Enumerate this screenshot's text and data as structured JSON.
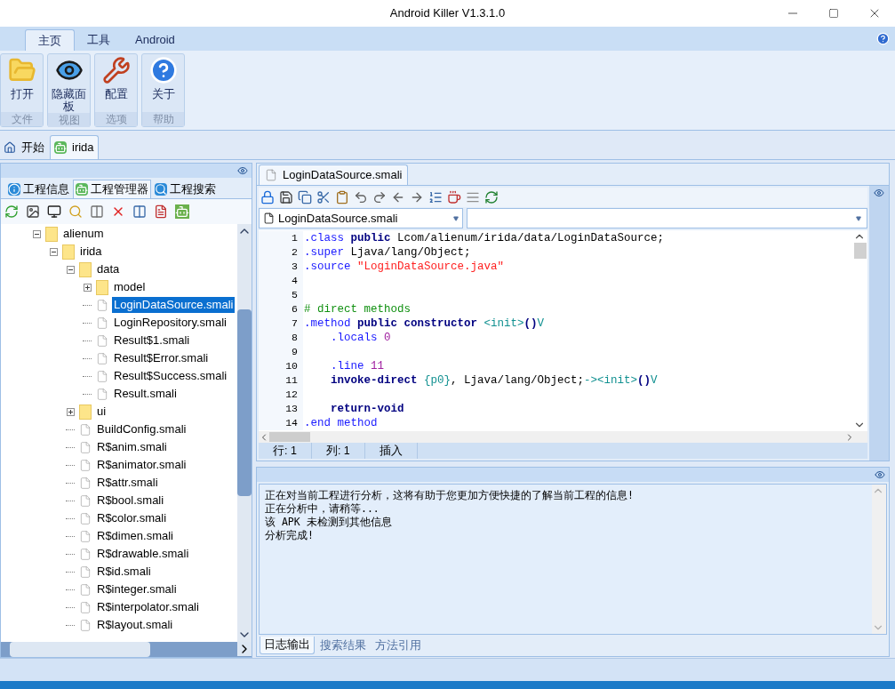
{
  "window": {
    "title": "Android Killer V1.3.1.0"
  },
  "ribbon_tabs": [
    {
      "label": "主页",
      "selected": true
    },
    {
      "label": "工具",
      "selected": false
    },
    {
      "label": "Android",
      "selected": false
    }
  ],
  "ribbon_groups": [
    {
      "label": "文件",
      "buttons": [
        {
          "kind": "open",
          "label": "打开"
        }
      ]
    },
    {
      "label": "视图",
      "buttons": [
        {
          "kind": "eye",
          "label": "隐藏面板"
        }
      ]
    },
    {
      "label": "选项",
      "buttons": [
        {
          "kind": "tools",
          "label": "配置"
        }
      ]
    },
    {
      "label": "帮助",
      "buttons": [
        {
          "kind": "help",
          "label": "关于"
        }
      ]
    }
  ],
  "doc_tabs": [
    {
      "kind": "home",
      "label": "开始",
      "selected": false
    },
    {
      "kind": "android",
      "label": "irida",
      "selected": true
    }
  ],
  "left_panel": {
    "tabs": [
      {
        "kind": "info",
        "label": "工程信息",
        "selected": false
      },
      {
        "kind": "android",
        "label": "工程管理器",
        "selected": true
      },
      {
        "kind": "search",
        "label": "工程搜索",
        "selected": false
      }
    ],
    "tree": [
      {
        "kind": "folder",
        "label": "alienum",
        "expanded": true,
        "children": [
          {
            "kind": "folder",
            "label": "irida",
            "expanded": true,
            "children": [
              {
                "kind": "folder",
                "label": "data",
                "expanded": true,
                "children": [
                  {
                    "kind": "folder",
                    "label": "model",
                    "expanded": false
                  },
                  {
                    "kind": "file",
                    "label": "LoginDataSource.smali",
                    "selected": true
                  },
                  {
                    "kind": "file",
                    "label": "LoginRepository.smali",
                    "selected": false
                  },
                  {
                    "kind": "file",
                    "label": "Result$1.smali",
                    "selected": false
                  },
                  {
                    "kind": "file",
                    "label": "Result$Error.smali",
                    "selected": false
                  },
                  {
                    "kind": "file",
                    "label": "Result$Success.smali",
                    "selected": false
                  },
                  {
                    "kind": "file",
                    "label": "Result.smali",
                    "selected": false
                  }
                ]
              },
              {
                "kind": "folder",
                "label": "ui",
                "expanded": false
              },
              {
                "kind": "file",
                "label": "BuildConfig.smali",
                "selected": false
              },
              {
                "kind": "file",
                "label": "R$anim.smali",
                "selected": false
              },
              {
                "kind": "file",
                "label": "R$animator.smali",
                "selected": false
              },
              {
                "kind": "file",
                "label": "R$attr.smali",
                "selected": false
              },
              {
                "kind": "file",
                "label": "R$bool.smali",
                "selected": false
              },
              {
                "kind": "file",
                "label": "R$color.smali",
                "selected": false
              },
              {
                "kind": "file",
                "label": "R$dimen.smali",
                "selected": false
              },
              {
                "kind": "file",
                "label": "R$drawable.smali",
                "selected": false
              },
              {
                "kind": "file",
                "label": "R$id.smali",
                "selected": false
              },
              {
                "kind": "file",
                "label": "R$integer.smali",
                "selected": false
              },
              {
                "kind": "file",
                "label": "R$interpolator.smali",
                "selected": false
              },
              {
                "kind": "file",
                "label": "R$layout.smali",
                "selected": false
              }
            ]
          }
        ]
      }
    ]
  },
  "editor": {
    "tab": "LoginDataSource.smali",
    "file_select": "LoginDataSource.smali",
    "lines": [
      {
        "number": "1",
        "tokens": [
          {
            "kind": "directive",
            "text": ".class"
          },
          {
            "kind": "keyword",
            "text": " public"
          },
          {
            "kind": "plain",
            "text": " Lcom/alienum/irida/data/LoginDataSource;"
          }
        ]
      },
      {
        "number": "2",
        "tokens": [
          {
            "kind": "directive",
            "text": ".super"
          },
          {
            "kind": "plain",
            "text": " Ljava/lang/Object;"
          }
        ]
      },
      {
        "number": "3",
        "tokens": [
          {
            "kind": "directive",
            "text": ".source"
          },
          {
            "kind": "string",
            "text": " \"LoginDataSource.java\""
          }
        ]
      },
      {
        "number": "4"
      },
      {
        "number": "5"
      },
      {
        "number": "6",
        "tokens": [
          {
            "kind": "comment",
            "text": "# direct methods"
          }
        ]
      },
      {
        "number": "7",
        "tokens": [
          {
            "kind": "directive",
            "text": ".method"
          },
          {
            "kind": "keyword",
            "text": " public constructor"
          },
          {
            "kind": "type",
            "text": " <init>"
          },
          {
            "kind": "keyword",
            "text": "()"
          },
          {
            "kind": "type",
            "text": "V"
          }
        ]
      },
      {
        "number": "8",
        "tokens": [
          {
            "kind": "directive",
            "text": "    .locals"
          },
          {
            "kind": "number",
            "text": " 0"
          }
        ]
      },
      {
        "number": "9"
      },
      {
        "number": "10",
        "tokens": [
          {
            "kind": "directive",
            "text": "    .line"
          },
          {
            "kind": "number",
            "text": " 11"
          }
        ]
      },
      {
        "number": "11",
        "tokens": [
          {
            "kind": "keyword",
            "text": "    invoke-direct"
          },
          {
            "kind": "type",
            "text": " {p0}"
          },
          {
            "kind": "plain",
            "text": ", Ljava/lang/Object;"
          },
          {
            "kind": "type",
            "text": "-><init>"
          },
          {
            "kind": "keyword",
            "text": "()"
          },
          {
            "kind": "type",
            "text": "V"
          }
        ]
      },
      {
        "number": "12"
      },
      {
        "number": "13",
        "tokens": [
          {
            "kind": "keyword",
            "text": "    return-void"
          }
        ]
      },
      {
        "number": "14",
        "tokens": [
          {
            "kind": "directive",
            "text": ".end method"
          }
        ]
      }
    ],
    "status": [
      "行: 1",
      "列: 1",
      "插入"
    ]
  },
  "log": {
    "lines": [
      "正在对当前工程进行分析，这将有助于您更加方便快捷的了解当前工程的信息!",
      "正在分析中，请稍等...",
      "该 APK 未检测到其他信息",
      "分析完成!"
    ],
    "tabs": [
      {
        "label": "日志输出",
        "selected": true
      },
      {
        "label": "搜索结果",
        "selected": false
      },
      {
        "label": "方法引用",
        "selected": false
      }
    ]
  }
}
